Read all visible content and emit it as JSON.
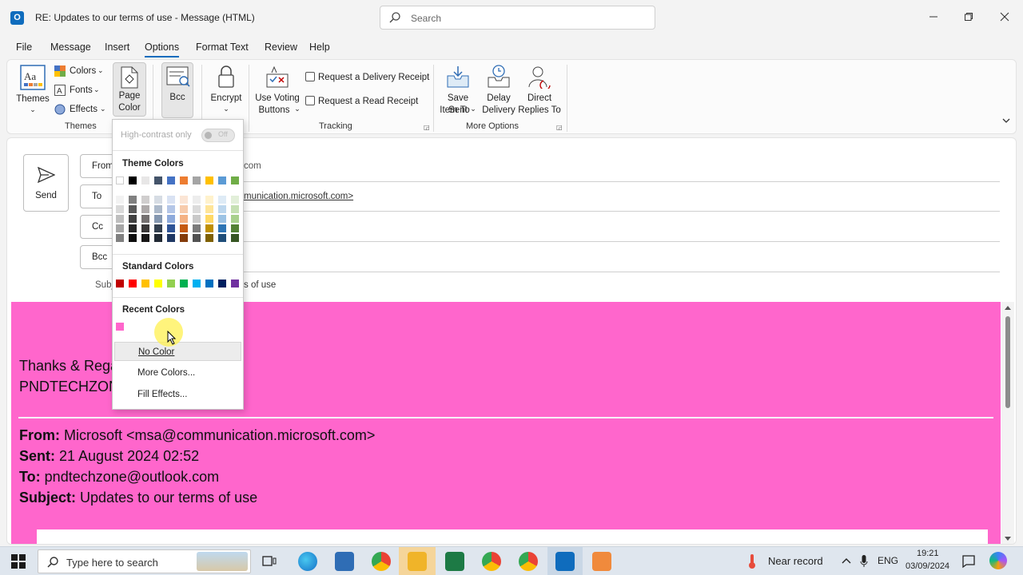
{
  "window": {
    "app_icon_letter": "O",
    "title": "RE: Updates to our terms of use  -  Message (HTML)",
    "search_placeholder": "Search"
  },
  "menu": {
    "tabs": [
      "File",
      "Message",
      "Insert",
      "Options",
      "Format Text",
      "Review",
      "Help"
    ],
    "active": "Options"
  },
  "ribbon": {
    "themes": {
      "themes_label": "Themes",
      "colors_label": "Colors",
      "fonts_label": "Fonts",
      "effects_label": "Effects",
      "page_color_line1": "Page",
      "page_color_line2": "Color",
      "group_label": "Themes"
    },
    "bcc_label": "Bcc",
    "encrypt_label": "Encrypt",
    "voting_line1": "Use Voting",
    "voting_line2": "Buttons",
    "tracking": {
      "delivery_receipt": "Request a Delivery Receipt",
      "read_receipt": "Request a Read Receipt",
      "group_label": "Tracking"
    },
    "more_options": {
      "save_sent_line1": "Save Sent",
      "save_sent_line2": "Item To",
      "delay_line1": "Delay",
      "delay_line2": "Delivery",
      "direct_line1": "Direct",
      "direct_line2": "Replies To",
      "group_label": "More Options"
    }
  },
  "compose": {
    "send_label": "Send",
    "from_label": "From",
    "to_label": "To",
    "cc_label": "Cc",
    "bcc_label": "Bcc",
    "subject_label": "Subj",
    "from_value_visible": "com",
    "to_value_visible": "munication.microsoft.com>",
    "subject_value_visible": "s of use",
    "page_color": "#ff66cc",
    "body": {
      "thanks_visible": "Thanks & Rega",
      "signature_visible": "PNDTECHZON",
      "from_label": "From:",
      "from_value": "Microsoft <msa@communication.microsoft.com>",
      "sent_label": "Sent:",
      "sent_value": "21 August 2024 02:52",
      "to_label": "To:",
      "to_value": "pndtechzone@outlook.com",
      "subject_label": "Subject:",
      "subject_value": "Updates to our terms of use"
    }
  },
  "dropdown": {
    "high_contrast_label": "High-contrast only",
    "toggle_label": "Off",
    "theme_colors_heading": "Theme Colors",
    "standard_colors_heading": "Standard Colors",
    "recent_colors_heading": "Recent Colors",
    "no_color": "No Color",
    "more_colors": "More Colors...",
    "fill_effects": "Fill Effects...",
    "theme_top_row": [
      "#ffffff",
      "#000000",
      "#e7e6e6",
      "#44546a",
      "#4472c4",
      "#ed7d31",
      "#a5a5a5",
      "#ffc000",
      "#5b9bd5",
      "#70ad47"
    ],
    "theme_columns": [
      [
        "#f2f2f2",
        "#d9d9d9",
        "#bfbfbf",
        "#a6a6a6",
        "#808080"
      ],
      [
        "#808080",
        "#595959",
        "#404040",
        "#262626",
        "#0d0d0d"
      ],
      [
        "#d0cece",
        "#aeaaaa",
        "#757171",
        "#3a3838",
        "#171616"
      ],
      [
        "#d6dce4",
        "#acb9ca",
        "#8497b0",
        "#333f4f",
        "#222a35"
      ],
      [
        "#d9e2f3",
        "#b4c6e7",
        "#8eaadb",
        "#2f5496",
        "#1f3864"
      ],
      [
        "#fbe5d5",
        "#f7cbac",
        "#f4b183",
        "#c55a11",
        "#843c0b"
      ],
      [
        "#ededed",
        "#dbdbdb",
        "#c9c9c9",
        "#7b7b7b",
        "#525252"
      ],
      [
        "#fff2cc",
        "#ffe598",
        "#ffd965",
        "#bf8f00",
        "#7f6000"
      ],
      [
        "#deebf6",
        "#bdd7ee",
        "#9cc3e5",
        "#2e75b5",
        "#1f4e79"
      ],
      [
        "#e2efd9",
        "#c5e0b3",
        "#a8d08d",
        "#538135",
        "#375623"
      ]
    ],
    "standard_colors": [
      "#c00000",
      "#ff0000",
      "#ffc000",
      "#ffff00",
      "#92d050",
      "#00b050",
      "#00b0f0",
      "#0070c0",
      "#002060",
      "#7030a0"
    ],
    "recent_colors": [
      "#ff66cc"
    ]
  },
  "taskbar": {
    "search_placeholder": "Type here to search",
    "weather": "Near record",
    "language": "ENG",
    "time": "19:21",
    "date": "03/09/2024"
  }
}
